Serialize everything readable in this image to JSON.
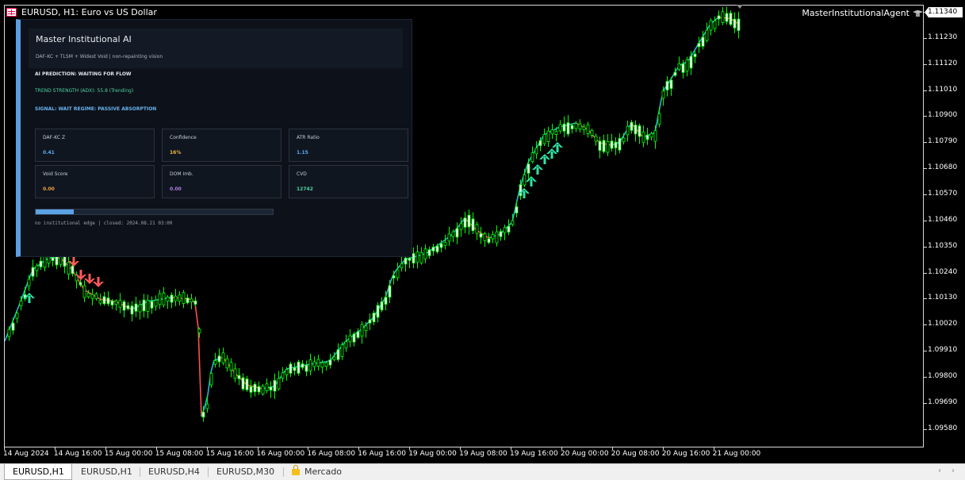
{
  "window": {
    "title": "EURUSD, H1:  Euro vs US Dollar",
    "agent": "MasterInstitutionalAgent",
    "current_price": "1.11340"
  },
  "y_axis": {
    "labels": [
      "1.11340",
      "1.11230",
      "1.11120",
      "1.11010",
      "1.10900",
      "1.10790",
      "1.10680",
      "1.10570",
      "1.10460",
      "1.10350",
      "1.10240",
      "1.10130",
      "1.10020",
      "1.09910",
      "1.09800",
      "1.09690",
      "1.09580"
    ]
  },
  "x_axis": {
    "labels": [
      "14 Aug 2024",
      "14 Aug 16:00",
      "15 Aug 00:00",
      "15 Aug 08:00",
      "15 Aug 16:00",
      "16 Aug 00:00",
      "16 Aug 08:00",
      "16 Aug 16:00",
      "19 Aug 00:00",
      "19 Aug 08:00",
      "19 Aug 16:00",
      "20 Aug 00:00",
      "20 Aug 08:00",
      "20 Aug 16:00",
      "21 Aug 00:00"
    ]
  },
  "panel": {
    "title": "Master Institutional AI",
    "subtitle": "DAF-KC + TLSM + Widest Void | non-repainting vision",
    "prediction": "AI PREDICTION: WAITING FOR FLOW",
    "trend": "TREND STRENGTH (ADX): 55.8 (Trending)",
    "signal": "SIGNAL: WAIT   REGIME: PASSIVE ABSORPTION",
    "metrics": [
      {
        "label": "DAF-KC Z",
        "value": "0.41",
        "color": "#5aa9f0"
      },
      {
        "label": "Confidence",
        "value": "16%",
        "color": "#f0b840"
      },
      {
        "label": "ATR Ratio",
        "value": "1.15",
        "color": "#5aa9f0"
      },
      {
        "label": "Void Score",
        "value": "0.00",
        "color": "#f0a040"
      },
      {
        "label": "DOM Imb.",
        "value": "0.00",
        "color": "#b07ce8"
      },
      {
        "label": "CVD",
        "value": "12742",
        "color": "#4dd3a3"
      }
    ],
    "progress_fraction": 0.16,
    "footer": "no institutional edge | closed: 2024.08.21 03:00"
  },
  "tabs": [
    {
      "label": "EURUSD,H1",
      "active": true
    },
    {
      "label": "EURUSD,H1",
      "active": false
    },
    {
      "label": "EURUSD,H4",
      "active": false
    },
    {
      "label": "EURUSD,M30",
      "active": false
    },
    {
      "label": "Mercado",
      "active": false,
      "icon": "lock-icon"
    }
  ],
  "colors": {
    "bull_candle": "#00ff00",
    "bear_candle": "#ffffff",
    "line_up": "#2ab7c9",
    "line_down": "#ff4e4e",
    "buy_arrow": "#2fe3a4",
    "sell_arrow": "#ff5a5a"
  }
}
